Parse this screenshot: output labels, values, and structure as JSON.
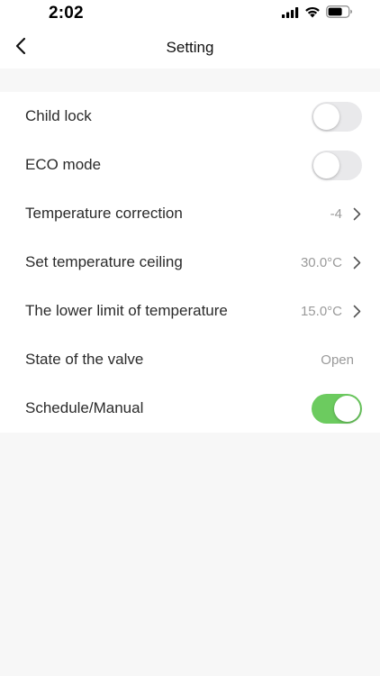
{
  "status_bar": {
    "time": "2:02",
    "icons": [
      "signal-icon",
      "wifi-icon",
      "battery-icon"
    ]
  },
  "header": {
    "title": "Setting",
    "back_icon": "chevron-left-icon"
  },
  "settings": {
    "child_lock": {
      "label": "Child lock",
      "enabled": false
    },
    "eco_mode": {
      "label": "ECO mode",
      "enabled": false
    },
    "temperature_correction": {
      "label": "Temperature correction",
      "value": "-4"
    },
    "temperature_ceiling": {
      "label": "Set temperature ceiling",
      "value": "30.0°C"
    },
    "temperature_lower_limit": {
      "label": "The lower limit of temperature",
      "value": "15.0°C"
    },
    "valve_state": {
      "label": "State of the valve",
      "value": "Open"
    },
    "schedule_manual": {
      "label": "Schedule/Manual",
      "enabled": true
    }
  },
  "colors": {
    "toggle_on": "#6ccb5f",
    "toggle_off": "#e9e9eb",
    "page_background": "#f7f7f7",
    "value_text": "#9a9a9a"
  }
}
